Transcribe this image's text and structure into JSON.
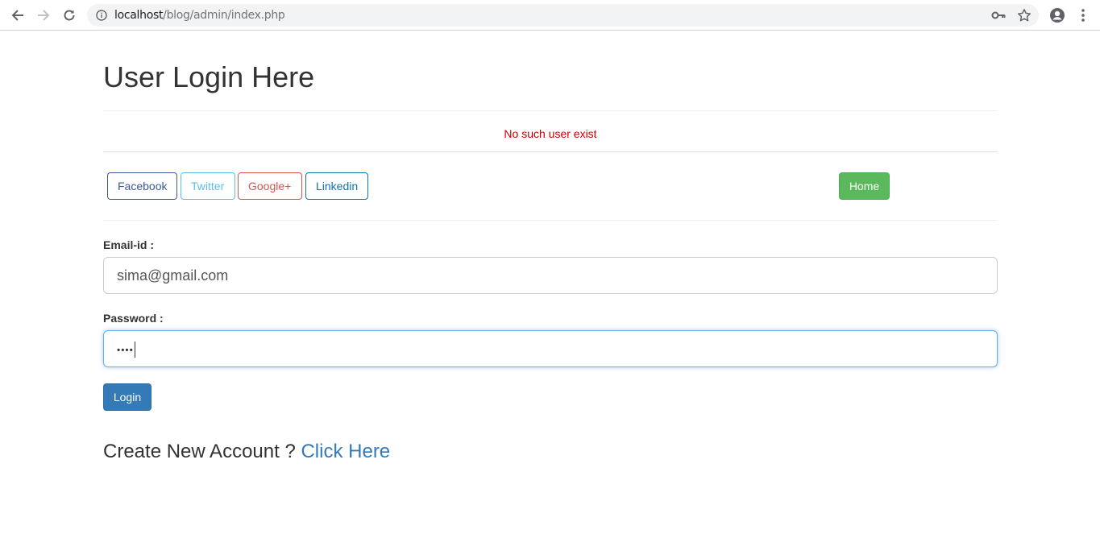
{
  "browser": {
    "url_host": "localhost",
    "url_path": "/blog/admin/index.php"
  },
  "page": {
    "title": "User Login Here",
    "error_message": "No such user exist",
    "social_buttons": {
      "facebook": "Facebook",
      "twitter": "Twitter",
      "google": "Google+",
      "linkedin": "Linkedin"
    },
    "home_button": "Home",
    "email_label": "Email-id :",
    "email_value": "sima@gmail.com",
    "password_label": "Password :",
    "password_value": "••••",
    "login_button": "Login",
    "create_account_text": "Create New Account ?",
    "create_account_link": "Click Here"
  },
  "colors": {
    "error": "#cc0000",
    "facebook": "#3b5998",
    "twitter": "#5bc0de",
    "google": "#d9534f",
    "linkedin": "#0e76a8",
    "home": "#5cb85c",
    "primary": "#337ab7"
  }
}
